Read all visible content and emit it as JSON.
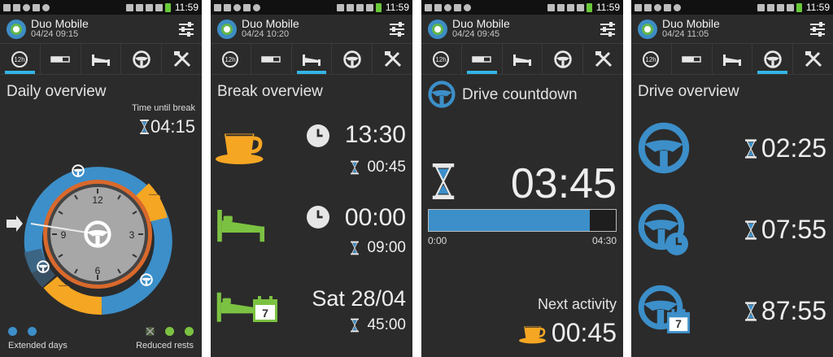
{
  "colors": {
    "accent": "#33b5e5",
    "drive_blue": "#3c8fc9",
    "break_orange": "#f5a623",
    "rest_green": "#7cc242",
    "background": "#2b2b2b"
  },
  "status_bar": {
    "time": "11:59"
  },
  "app": {
    "name": "Duo Mobile"
  },
  "tab_icons": [
    "12h-clock-icon",
    "work-bar-icon",
    "bed-icon",
    "steering-wheel-icon",
    "tools-icon"
  ],
  "screens": [
    {
      "date": "04/24 09:15",
      "heading": "Daily overview",
      "time_until_break_label": "Time until break",
      "time_until_break": "04:15",
      "dial_numbers": [
        "12",
        "3",
        "6",
        "9"
      ],
      "legend_left": "Extended days",
      "legend_right": "Reduced rests"
    },
    {
      "date": "04/24 10:20",
      "heading": "Break overview",
      "rows": [
        {
          "icon": "coffee-cup-icon",
          "time": "13:30",
          "remaining": "00:45"
        },
        {
          "icon": "bed-icon",
          "time": "00:00",
          "remaining": "09:00"
        },
        {
          "icon": "bed-calendar-icon",
          "time": "Sat 28/04",
          "remaining": "45:00",
          "calendar_day": "7"
        }
      ]
    },
    {
      "date": "04/24 09:45",
      "heading": "Drive countdown",
      "countdown": "03:45",
      "progress_fraction": 0.86,
      "bar_min": "0:00",
      "bar_max": "04:30",
      "next_activity_label": "Next activity",
      "next_activity_time": "00:45"
    },
    {
      "date": "04/24 11:05",
      "heading": "Drive overview",
      "rows": [
        {
          "icon": "steering-wheel-icon",
          "time": "02:25"
        },
        {
          "icon": "steering-wheel-clock-icon",
          "time": "07:55"
        },
        {
          "icon": "steering-wheel-calendar-icon",
          "time": "87:55",
          "calendar_day": "7"
        }
      ]
    }
  ]
}
